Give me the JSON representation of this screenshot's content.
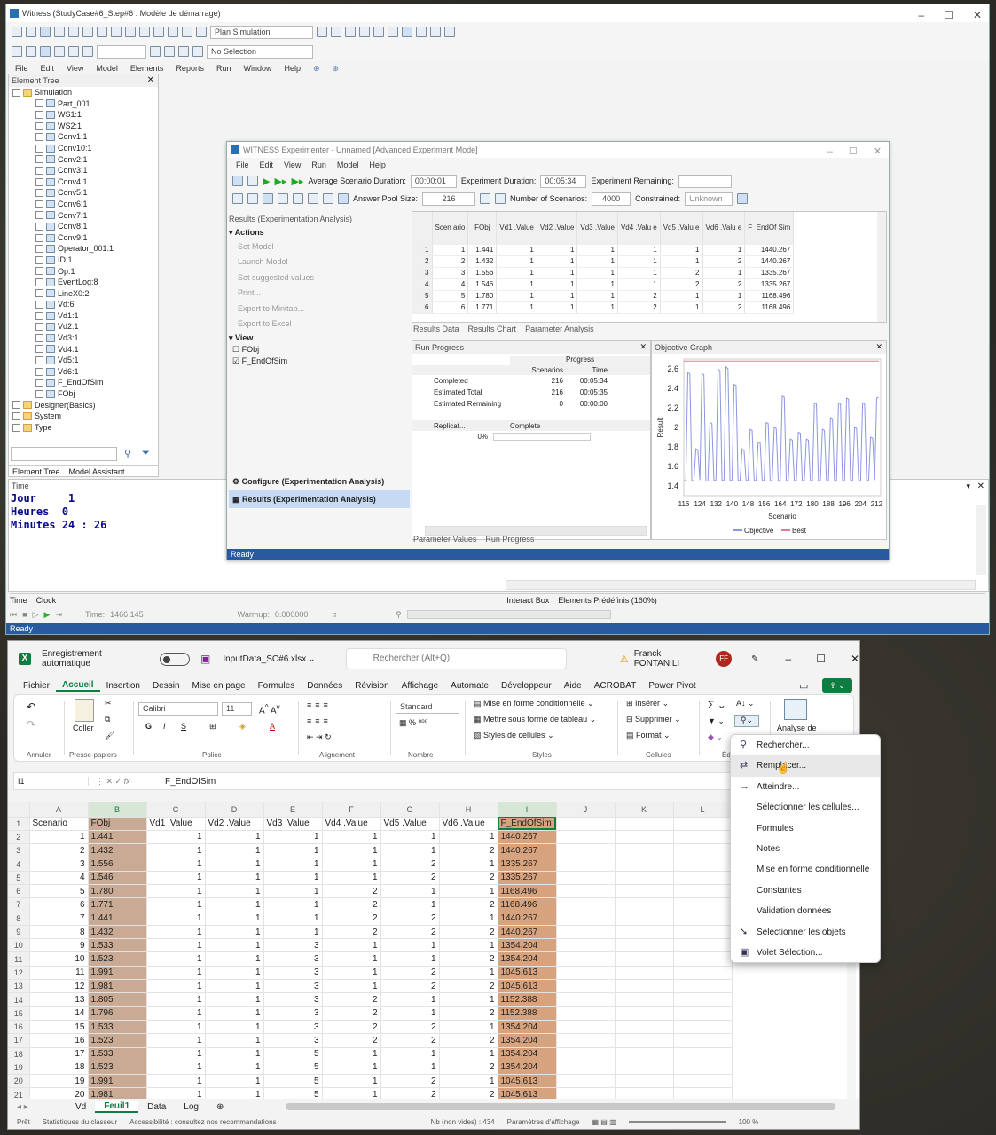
{
  "witness": {
    "title": "Witness (StudyCase#6_Step#6 : Modèle de démarrage)",
    "plan_select": "Plan Simulation",
    "selection_select": "No Selection",
    "menu": [
      "File",
      "Edit",
      "View",
      "Model",
      "Elements",
      "Reports",
      "Run",
      "Window",
      "Help"
    ],
    "element_tree_title": "Element Tree",
    "tree": [
      "Simulation",
      "Part_001",
      "WS1:1",
      "WS2:1",
      "Conv1:1",
      "Conv10:1",
      "Conv2:1",
      "Conv3:1",
      "Conv4:1",
      "Conv5:1",
      "Conv6:1",
      "Conv7:1",
      "Conv8:1",
      "Conv9:1",
      "Operator_001:1",
      "ID:1",
      "Op:1",
      "EventLog:8",
      "LineX0:2",
      "Vd:6",
      "Vd1:1",
      "Vd2:1",
      "Vd3:1",
      "Vd4:1",
      "Vd5:1",
      "Vd6:1",
      "F_EndOfSim",
      "FObj",
      "Designer(Basics)",
      "System",
      "Type"
    ],
    "tree_tabs": [
      "Element Tree",
      "Model Assistant"
    ],
    "time_label": "Time",
    "clock": [
      {
        "k": "Jour",
        "v": "1"
      },
      {
        "k": "Heures",
        "v": "0"
      },
      {
        "k": "Minutes",
        "v": "24 : 26"
      }
    ],
    "bottom_tabs": [
      "Time",
      "Clock"
    ],
    "right_tabs": [
      "Interact Box",
      "Elements Prédéfinis (160%)"
    ],
    "time_value_label": "Time:",
    "time_value": "1466.145",
    "warmup_label": "Warmup:",
    "warmup_value": "0.000000",
    "status": "Ready"
  },
  "exp": {
    "title": "WITNESS Experimenter - Unnamed [Advanced Experiment Mode]",
    "menu": [
      "File",
      "Edit",
      "View",
      "Run",
      "Model",
      "Help"
    ],
    "avg_label": "Average Scenario Duration:",
    "avg_value": "00:00:01",
    "dur_label": "Experiment Duration:",
    "dur_value": "00:05:34",
    "rem_label": "Experiment Remaining:",
    "pool_label": "Answer Pool Size:",
    "pool_value": "216",
    "nscen_label": "Number of Scenarios:",
    "nscen_value": "4000",
    "constr_label": "Constrained:",
    "constr_value": "Unknown",
    "results_header": "Results (Experimentation Analysis)",
    "actions_title": "Actions",
    "actions": [
      "Set Model",
      "Launch Model",
      "Set suggested values",
      "Print...",
      "Export to Minitab...",
      "Export to Excel"
    ],
    "view_title": "View",
    "view_items": [
      "FObj",
      "F_EndOfSim"
    ],
    "configure": "Configure (Experimentation Analysis)",
    "results_item": "Results (Experimentation Analysis)",
    "grid_headers": [
      "Scen ario",
      "FObj",
      "Vd1 .Value",
      "Vd2 .Value",
      "Vd3 .Value",
      "Vd4 .Valu e",
      "Vd5 .Valu e",
      "Vd6 .Valu e",
      "F_EndOf Sim"
    ],
    "grid_rows": [
      [
        "1",
        "1",
        "1.441",
        "1",
        "1",
        "1",
        "1",
        "1",
        "1",
        "1440.267"
      ],
      [
        "2",
        "2",
        "1.432",
        "1",
        "1",
        "1",
        "1",
        "1",
        "2",
        "1440.267"
      ],
      [
        "3",
        "3",
        "1.556",
        "1",
        "1",
        "1",
        "1",
        "2",
        "1",
        "1335.267"
      ],
      [
        "4",
        "4",
        "1.546",
        "1",
        "1",
        "1",
        "1",
        "2",
        "2",
        "1335.267"
      ],
      [
        "5",
        "5",
        "1.780",
        "1",
        "1",
        "1",
        "2",
        "1",
        "1",
        "1168.496"
      ],
      [
        "6",
        "6",
        "1.771",
        "1",
        "1",
        "1",
        "2",
        "1",
        "2",
        "1168.496"
      ]
    ],
    "result_tabs": [
      "Results Data",
      "Results Chart",
      "Parameter Analysis"
    ],
    "run_progress_title": "Run Progress",
    "progress_header": "Progress",
    "col_scen": "Scenarios",
    "col_time": "Time",
    "progress_rows": [
      {
        "k": "Completed",
        "s": "216",
        "t": "00:05:34"
      },
      {
        "k": "Estimated Total",
        "s": "216",
        "t": "00:05:35"
      },
      {
        "k": "Estimated Remaining",
        "s": "0",
        "t": "00:00:00"
      }
    ],
    "rep_col": "Replicat...",
    "complete_col": "Complete",
    "rep_pct": "0%",
    "bottom_tabs": [
      "Parameter Values",
      "Run Progress"
    ],
    "status": "Ready"
  },
  "chart_data": {
    "type": "line",
    "title": "Objective Graph",
    "xlabel": "Scenario",
    "ylabel": "Result",
    "xlim": [
      116,
      214
    ],
    "ylim": [
      1.3,
      2.7
    ],
    "xticks": [
      116,
      124,
      132,
      140,
      148,
      156,
      164,
      172,
      180,
      188,
      196,
      204,
      212
    ],
    "yticks": [
      1.4,
      1.6,
      1.8,
      2,
      2.2,
      2.4,
      2.6
    ],
    "series": [
      {
        "name": "Objective",
        "color": "#8c96e0",
        "x": [
          116,
          117,
          118,
          119,
          120,
          121,
          122,
          123,
          124,
          125,
          126,
          127,
          128,
          129,
          130,
          131,
          132,
          133,
          134,
          135,
          136,
          137,
          138,
          139,
          140,
          141,
          142,
          143,
          144,
          145,
          146,
          147,
          148,
          149,
          150,
          151,
          152,
          153,
          154,
          155,
          156,
          157,
          158,
          159,
          160,
          161,
          162,
          163,
          164,
          165,
          166,
          167,
          168,
          169,
          170,
          171,
          172,
          173,
          174,
          175,
          176,
          177,
          178,
          179,
          180,
          181,
          182,
          183,
          184,
          185,
          186,
          187,
          188,
          189,
          190,
          191,
          192,
          193,
          194,
          195,
          196,
          197,
          198,
          199,
          200,
          201,
          202,
          203,
          204,
          205,
          206,
          207,
          208,
          209,
          210,
          211,
          212,
          213
        ],
        "y": [
          1.45,
          1.46,
          2.56,
          2.55,
          1.46,
          1.45,
          1.78,
          1.77,
          1.46,
          2.55,
          2.54,
          1.45,
          1.45,
          2.05,
          2.04,
          1.45,
          1.46,
          2.6,
          2.58,
          1.46,
          1.45,
          2.62,
          2.6,
          1.45,
          1.46,
          2.44,
          2.43,
          1.46,
          1.45,
          1.78,
          1.76,
          1.45,
          1.46,
          1.98,
          1.97,
          1.46,
          1.45,
          1.85,
          1.84,
          1.46,
          1.45,
          2.05,
          2.04,
          1.45,
          1.46,
          2.0,
          1.99,
          1.46,
          1.45,
          2.32,
          2.31,
          1.45,
          1.46,
          1.88,
          1.87,
          1.46,
          1.45,
          1.95,
          1.94,
          1.45,
          1.46,
          1.88,
          1.87,
          1.46,
          1.45,
          2.25,
          2.24,
          1.45,
          1.46,
          1.98,
          1.97,
          1.46,
          1.45,
          2.1,
          2.09,
          1.45,
          1.46,
          2.25,
          2.24,
          1.46,
          1.45,
          2.3,
          2.29,
          1.45,
          1.46,
          2.0,
          1.99,
          1.46,
          1.45,
          2.25,
          2.24,
          1.45,
          1.46,
          1.9,
          1.89,
          1.46,
          2.3,
          2.31
        ]
      },
      {
        "name": "Best",
        "color": "#e27b8e",
        "x": [
          116,
          213
        ],
        "y": [
          2.68,
          2.68
        ]
      }
    ]
  },
  "excel": {
    "autosave": "Enregistrement automatique",
    "filename": "InputData_SC#6.xlsx",
    "search_placeholder": "Rechercher (Alt+Q)",
    "user": "Franck FONTANILI",
    "initials": "FF",
    "tabs": [
      "Fichier",
      "Accueil",
      "Insertion",
      "Dessin",
      "Mise en page",
      "Formules",
      "Données",
      "Révision",
      "Affichage",
      "Automate",
      "Développeur",
      "Aide",
      "ACROBAT",
      "Power Pivot"
    ],
    "groups": [
      "Annuler",
      "Presse-papiers",
      "Police",
      "Alignement",
      "Nombre",
      "Styles",
      "Cellules",
      "Édi"
    ],
    "paste": "Coller",
    "font": "Calibri",
    "size": "11",
    "number_format": "Standard",
    "styles": [
      "Mise en forme conditionnelle",
      "Mettre sous forme de tableau",
      "Styles de cellules"
    ],
    "cells": [
      "Insérer",
      "Supprimer",
      "Format"
    ],
    "analyse": "Analyse de",
    "namebox": "I1",
    "fx": "fx",
    "formula": "F_EndOfSim",
    "columns": [
      "A",
      "B",
      "C",
      "D",
      "E",
      "F",
      "G",
      "H",
      "I",
      "J",
      "K",
      "L"
    ],
    "header_row": [
      "Scenario",
      "FObj",
      "Vd1 .Value",
      "Vd2 .Value",
      "Vd3 .Value",
      "Vd4 .Value",
      "Vd5 .Value",
      "Vd6 .Value",
      "F_EndOfSim"
    ],
    "rows": [
      [
        "1",
        "1.441",
        "1",
        "1",
        "1",
        "1",
        "1",
        "1",
        "1440.267"
      ],
      [
        "2",
        "1.432",
        "1",
        "1",
        "1",
        "1",
        "1",
        "2",
        "1440.267"
      ],
      [
        "3",
        "1.556",
        "1",
        "1",
        "1",
        "1",
        "2",
        "1",
        "1335.267"
      ],
      [
        "4",
        "1.546",
        "1",
        "1",
        "1",
        "1",
        "2",
        "2",
        "1335.267"
      ],
      [
        "5",
        "1.780",
        "1",
        "1",
        "1",
        "2",
        "1",
        "1",
        "1168.496"
      ],
      [
        "6",
        "1.771",
        "1",
        "1",
        "1",
        "2",
        "1",
        "2",
        "1168.496"
      ],
      [
        "7",
        "1.441",
        "1",
        "1",
        "1",
        "2",
        "2",
        "1",
        "1440.267"
      ],
      [
        "8",
        "1.432",
        "1",
        "1",
        "1",
        "2",
        "2",
        "2",
        "1440.267"
      ],
      [
        "9",
        "1.533",
        "1",
        "1",
        "3",
        "1",
        "1",
        "1",
        "1354.204"
      ],
      [
        "10",
        "1.523",
        "1",
        "1",
        "3",
        "1",
        "1",
        "2",
        "1354.204"
      ],
      [
        "11",
        "1.991",
        "1",
        "1",
        "3",
        "1",
        "2",
        "1",
        "1045.613"
      ],
      [
        "12",
        "1.981",
        "1",
        "1",
        "3",
        "1",
        "2",
        "2",
        "1045.613"
      ],
      [
        "13",
        "1.805",
        "1",
        "1",
        "3",
        "2",
        "1",
        "1",
        "1152.388"
      ],
      [
        "14",
        "1.796",
        "1",
        "1",
        "3",
        "2",
        "1",
        "2",
        "1152.388"
      ],
      [
        "15",
        "1.533",
        "1",
        "1",
        "3",
        "2",
        "2",
        "1",
        "1354.204"
      ],
      [
        "16",
        "1.523",
        "1",
        "1",
        "3",
        "2",
        "2",
        "2",
        "1354.204"
      ],
      [
        "17",
        "1.533",
        "1",
        "1",
        "5",
        "1",
        "1",
        "1",
        "1354.204"
      ],
      [
        "18",
        "1.523",
        "1",
        "1",
        "5",
        "1",
        "1",
        "2",
        "1354.204"
      ],
      [
        "19",
        "1.991",
        "1",
        "1",
        "5",
        "1",
        "2",
        "1",
        "1045.613"
      ],
      [
        "20",
        "1.981",
        "1",
        "1",
        "5",
        "1",
        "2",
        "2",
        "1045.613"
      ]
    ],
    "sheets": [
      "Vd",
      "Feuil1",
      "Data",
      "Log"
    ],
    "status": [
      "Prêt",
      "Statistiques du classeur",
      "Accessibilité : consultez nos recommandations",
      "Nb (non vides) : 434",
      "Paramètres d'affichage",
      "100 %"
    ],
    "context_menu": [
      {
        "label": "Rechercher...",
        "icon": "search-icon"
      },
      {
        "label": "Remplacer...",
        "icon": "replace-icon"
      },
      {
        "label": "Atteindre...",
        "icon": "arrow-right-icon"
      },
      {
        "label": "Sélectionner les cellules..."
      },
      {
        "label": "Formules"
      },
      {
        "label": "Notes"
      },
      {
        "label": "Mise en forme conditionnelle"
      },
      {
        "label": "Constantes"
      },
      {
        "label": "Validation données"
      },
      {
        "label": "Sélectionner les objets",
        "icon": "pointer-icon"
      },
      {
        "label": "Volet Sélection...",
        "icon": "selection-pane-icon"
      }
    ]
  }
}
